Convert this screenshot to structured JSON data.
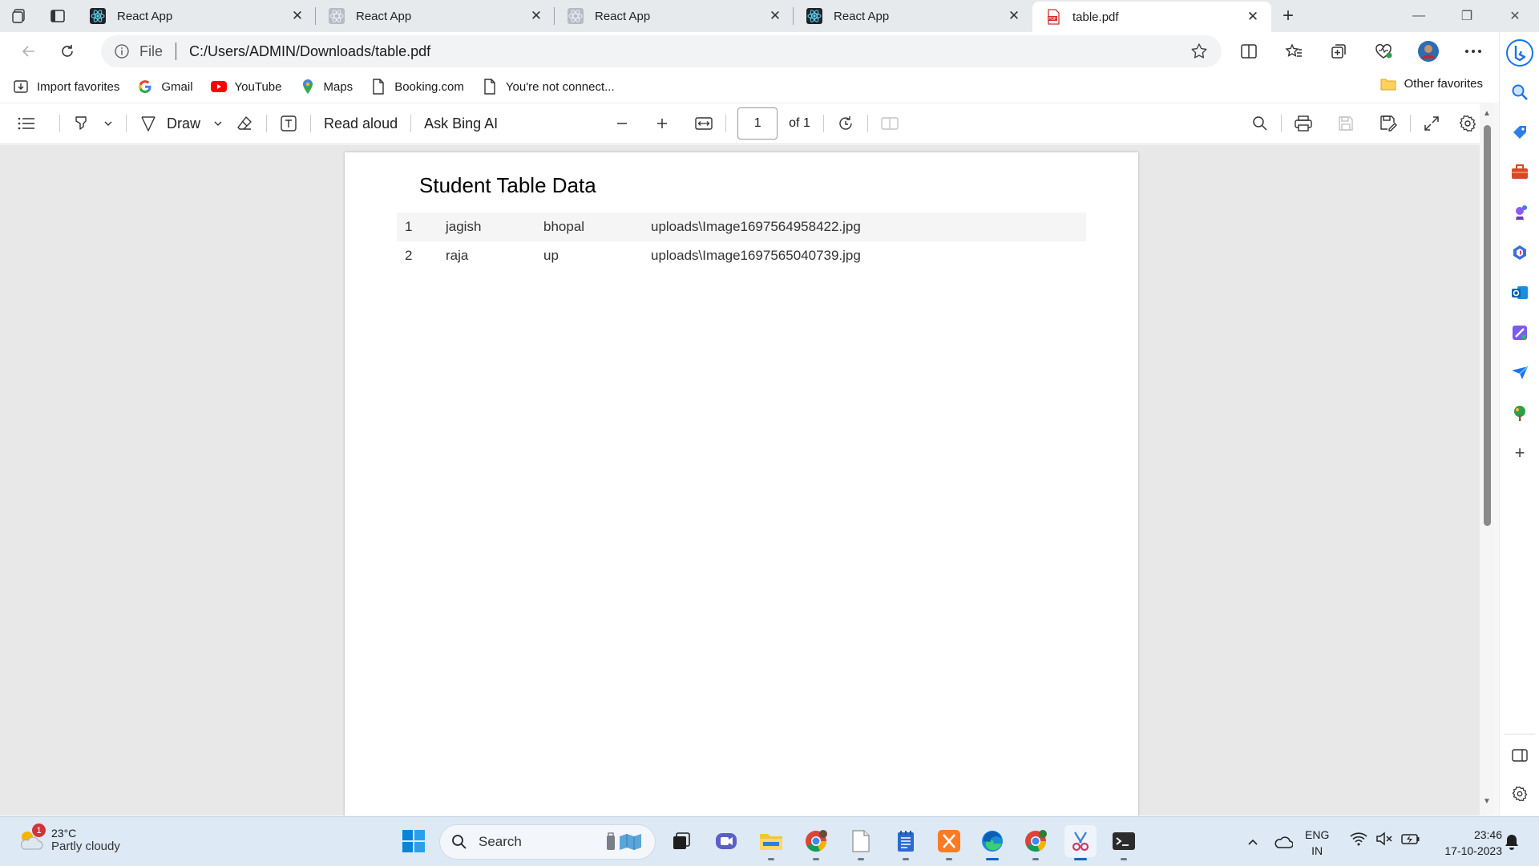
{
  "browser": {
    "tabs": [
      {
        "title": "React App",
        "icon": "react-icon",
        "active": false
      },
      {
        "title": "React App",
        "icon": "loading-globe-icon",
        "active": false
      },
      {
        "title": "React App",
        "icon": "loading-globe-icon",
        "active": false
      },
      {
        "title": "React App",
        "icon": "react-icon",
        "active": false
      },
      {
        "title": "table.pdf",
        "icon": "pdf-icon",
        "active": true
      }
    ],
    "address": {
      "scheme_label": "File",
      "url": "C:/Users/ADMIN/Downloads/table.pdf"
    },
    "favorites": [
      {
        "label": "Import favorites",
        "icon": "import-icon"
      },
      {
        "label": "Gmail",
        "icon": "google-icon"
      },
      {
        "label": "YouTube",
        "icon": "youtube-icon"
      },
      {
        "label": "Maps",
        "icon": "maps-pin-icon"
      },
      {
        "label": "Booking.com",
        "icon": "page-icon"
      },
      {
        "label": "You're not connect...",
        "icon": "page-icon"
      }
    ],
    "other_favorites": "Other favorites"
  },
  "pdf_toolbar": {
    "draw_label": "Draw",
    "read_aloud_label": "Read aloud",
    "ask_bing_label": "Ask Bing AI",
    "page_current": "1",
    "page_total_label": "of 1"
  },
  "document": {
    "title": "Student Table Data",
    "rows": [
      [
        "1",
        "jagish",
        "bhopal",
        "uploads\\Image1697564958422.jpg"
      ],
      [
        "2",
        "raja",
        "up",
        "uploads\\Image1697565040739.jpg"
      ]
    ]
  },
  "taskbar": {
    "weather_badge": "1",
    "weather_temp": "23°C",
    "weather_condition": "Partly cloudy",
    "search_label": "Search",
    "lang_line1": "ENG",
    "lang_line2": "IN",
    "time": "23:46",
    "date": "17-10-2023"
  },
  "colors": {
    "accent": "#0067c0",
    "tabstrip": "#e7eaed",
    "taskbar": "#dde9f5"
  }
}
